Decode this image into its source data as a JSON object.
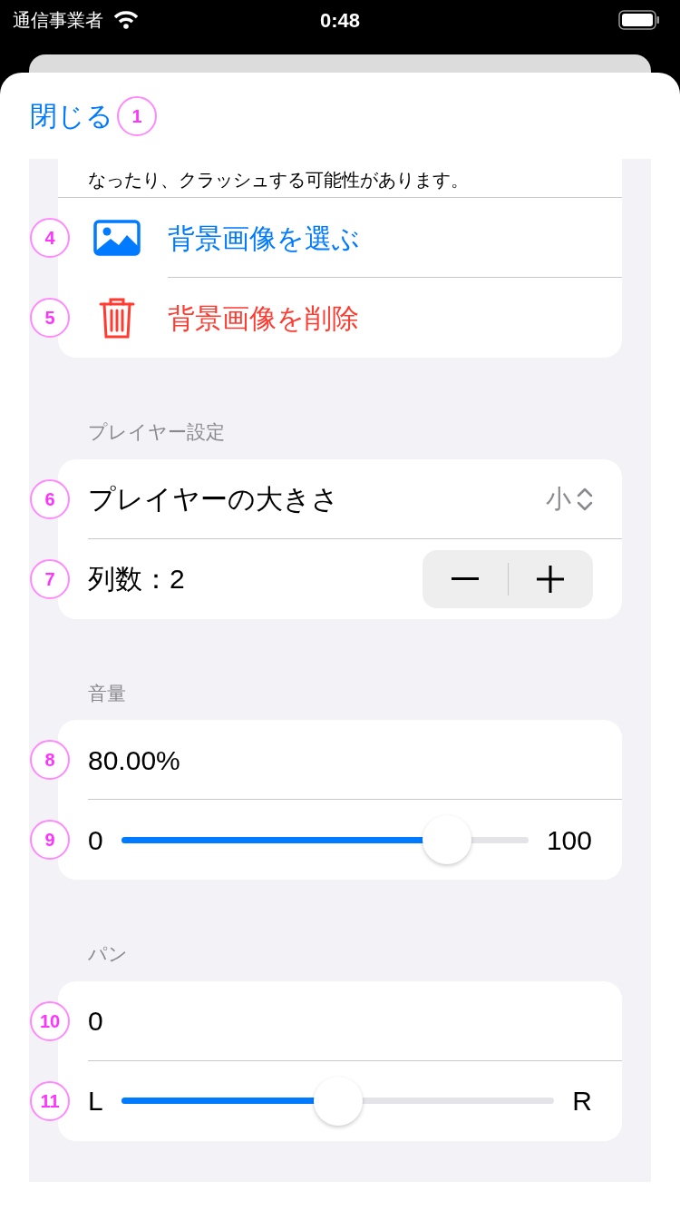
{
  "status_bar": {
    "carrier": "通信事業者",
    "time": "0:48"
  },
  "header": {
    "close": "閉じる",
    "badge": "1"
  },
  "background_section": {
    "note": "なったり、クラッシュする可能性があります。",
    "rows": [
      {
        "badge": "4",
        "kind": "choose",
        "label": "背景画像を選ぶ"
      },
      {
        "badge": "5",
        "kind": "delete",
        "label": "背景画像を削除"
      }
    ]
  },
  "player_section": {
    "title": "プレイヤー設定",
    "size": {
      "badge": "6",
      "label": "プレイヤーの大きさ",
      "value": "小"
    },
    "columns": {
      "badge": "7",
      "label": "列数：2"
    }
  },
  "volume_section": {
    "title": "音量",
    "reading": {
      "badge": "8",
      "text": "80.00%"
    },
    "slider": {
      "badge": "9",
      "min": "0",
      "max": "100",
      "level": 0.8
    }
  },
  "pan_section": {
    "title": "パン",
    "reading": {
      "badge": "10",
      "text": "0"
    },
    "slider": {
      "badge": "11",
      "min": "L",
      "max": "R",
      "level": 0.5
    }
  }
}
